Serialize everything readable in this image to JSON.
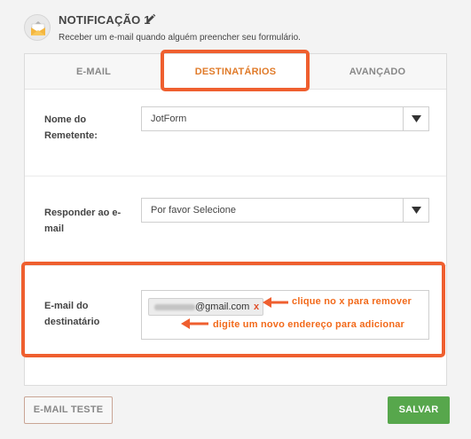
{
  "header": {
    "title": "NOTIFICAÇÃO 1",
    "subtitle": "Receber um e-mail quando alguém preencher seu formulário.",
    "icon": "mail-envelope-icon",
    "edit_icon": "pencil-icon"
  },
  "tabs": [
    {
      "label": "E-MAIL",
      "active": false
    },
    {
      "label": "DESTINATÁRIOS",
      "active": true
    },
    {
      "label": "AVANÇADO",
      "active": false
    }
  ],
  "fields": {
    "sender_name": {
      "label_line1": "Nome do",
      "label_line2": "Remetente:",
      "value": "JotForm"
    },
    "reply_to": {
      "label_line1": "Responder ao e-",
      "label_line2": "mail",
      "value": "Por favor Selecione"
    },
    "recipient": {
      "label_line1": "E-mail do",
      "label_line2": "destinatário",
      "email_domain": "@gmail.com",
      "remove_symbol": "x"
    }
  },
  "annotations": {
    "remove_hint": "clique no x para remover",
    "add_hint": "digite um novo endereço para adicionar",
    "color": "#f26a1b"
  },
  "buttons": {
    "test_email": "E-MAIL TESTE",
    "save": "SALVAR"
  },
  "colors": {
    "accent_orange": "#e07b2a",
    "highlight_box": "#ef5f2f",
    "save_green": "#57a74c"
  }
}
